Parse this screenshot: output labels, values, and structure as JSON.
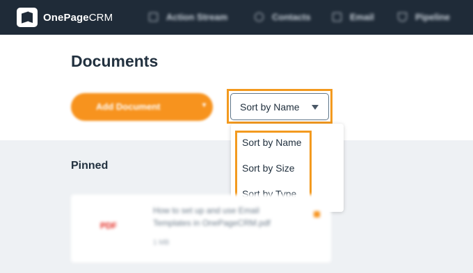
{
  "app": {
    "logo_bold": "OnePage",
    "logo_light": "CRM"
  },
  "nav": {
    "items": [
      {
        "label": "Action Stream",
        "icon": "checkbox-icon"
      },
      {
        "label": "Contacts",
        "icon": "person-icon"
      },
      {
        "label": "Email",
        "icon": "envelope-icon"
      },
      {
        "label": "Pipeline",
        "icon": "funnel-icon"
      }
    ]
  },
  "page": {
    "title": "Documents",
    "add_button_label": "Add Document"
  },
  "sort": {
    "selected": "Sort by Name",
    "options": [
      "Sort by Name",
      "Sort by Size",
      "Sort by Type"
    ]
  },
  "pinned": {
    "heading": "Pinned",
    "documents": [
      {
        "type_badge": "PDF",
        "name": "How to set up and use Email Templates in OnePageCRM.pdf",
        "size": "1 MB"
      }
    ]
  },
  "colors": {
    "accent": "#f7931e",
    "highlight": "#f39a1f",
    "topbar": "#1f2b38"
  }
}
